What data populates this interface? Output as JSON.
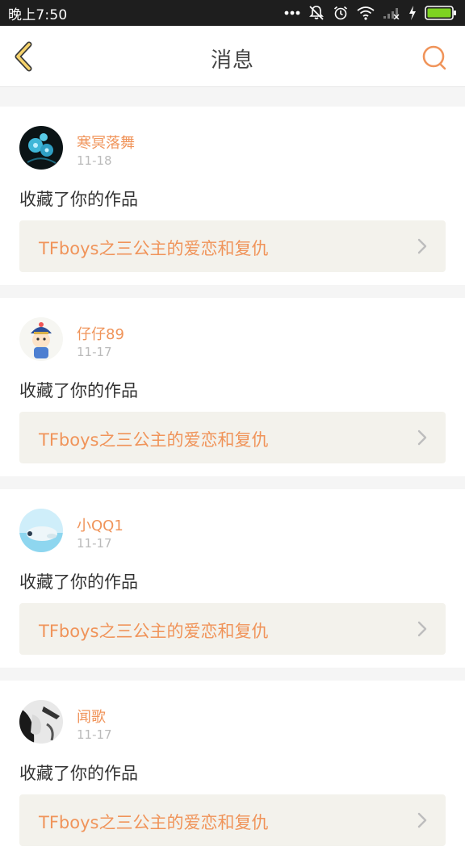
{
  "status_bar": {
    "time": "晚上7:50",
    "icons": [
      "more-dots-icon",
      "notifications-off-icon",
      "alarm-icon",
      "wifi-icon",
      "signal-icon",
      "charging-icon",
      "battery-icon"
    ]
  },
  "header": {
    "title": "消息",
    "back_icon": "chevron-left-icon",
    "search_icon": "search-icon"
  },
  "colors": {
    "accent": "#f0945a",
    "back_icon_fill": "#f6d36b",
    "link_background": "#f3f2ec",
    "page_background": "#f5f5f5"
  },
  "messages": [
    {
      "username": "寒冥落舞",
      "date": "11-18",
      "action": "收藏了你的作品",
      "work_title": "TFboys之三公主的爱恋和复仇"
    },
    {
      "username": "仔仔89",
      "date": "11-17",
      "action": "收藏了你的作品",
      "work_title": "TFboys之三公主的爱恋和复仇"
    },
    {
      "username": "小QQ1",
      "date": "11-17",
      "action": "收藏了你的作品",
      "work_title": "TFboys之三公主的爱恋和复仇"
    },
    {
      "username": "闻歌",
      "date": "11-17",
      "action": "收藏了你的作品",
      "work_title": "TFboys之三公主的爱恋和复仇"
    }
  ]
}
